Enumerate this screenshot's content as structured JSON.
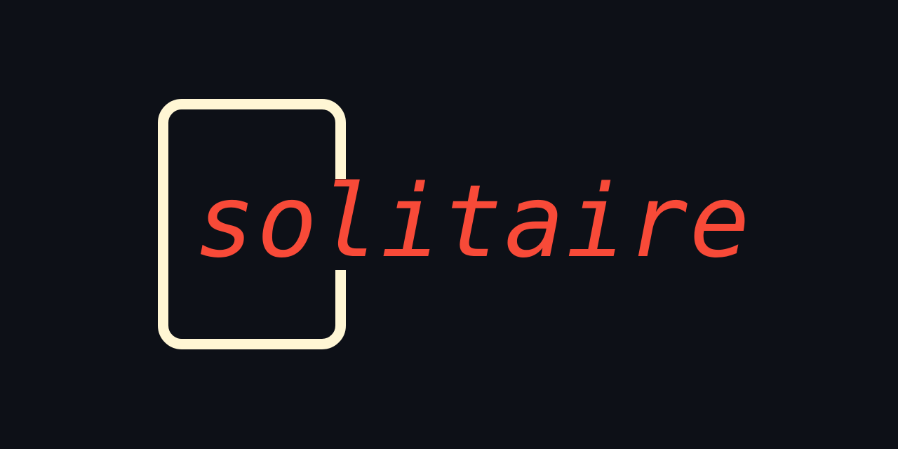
{
  "wordmark": {
    "text": "solitaire"
  },
  "icon": "card-outline-icon",
  "colors": {
    "background": "#0d1017",
    "card_outline": "#fff6d4",
    "wordmark": "#f84a38"
  }
}
